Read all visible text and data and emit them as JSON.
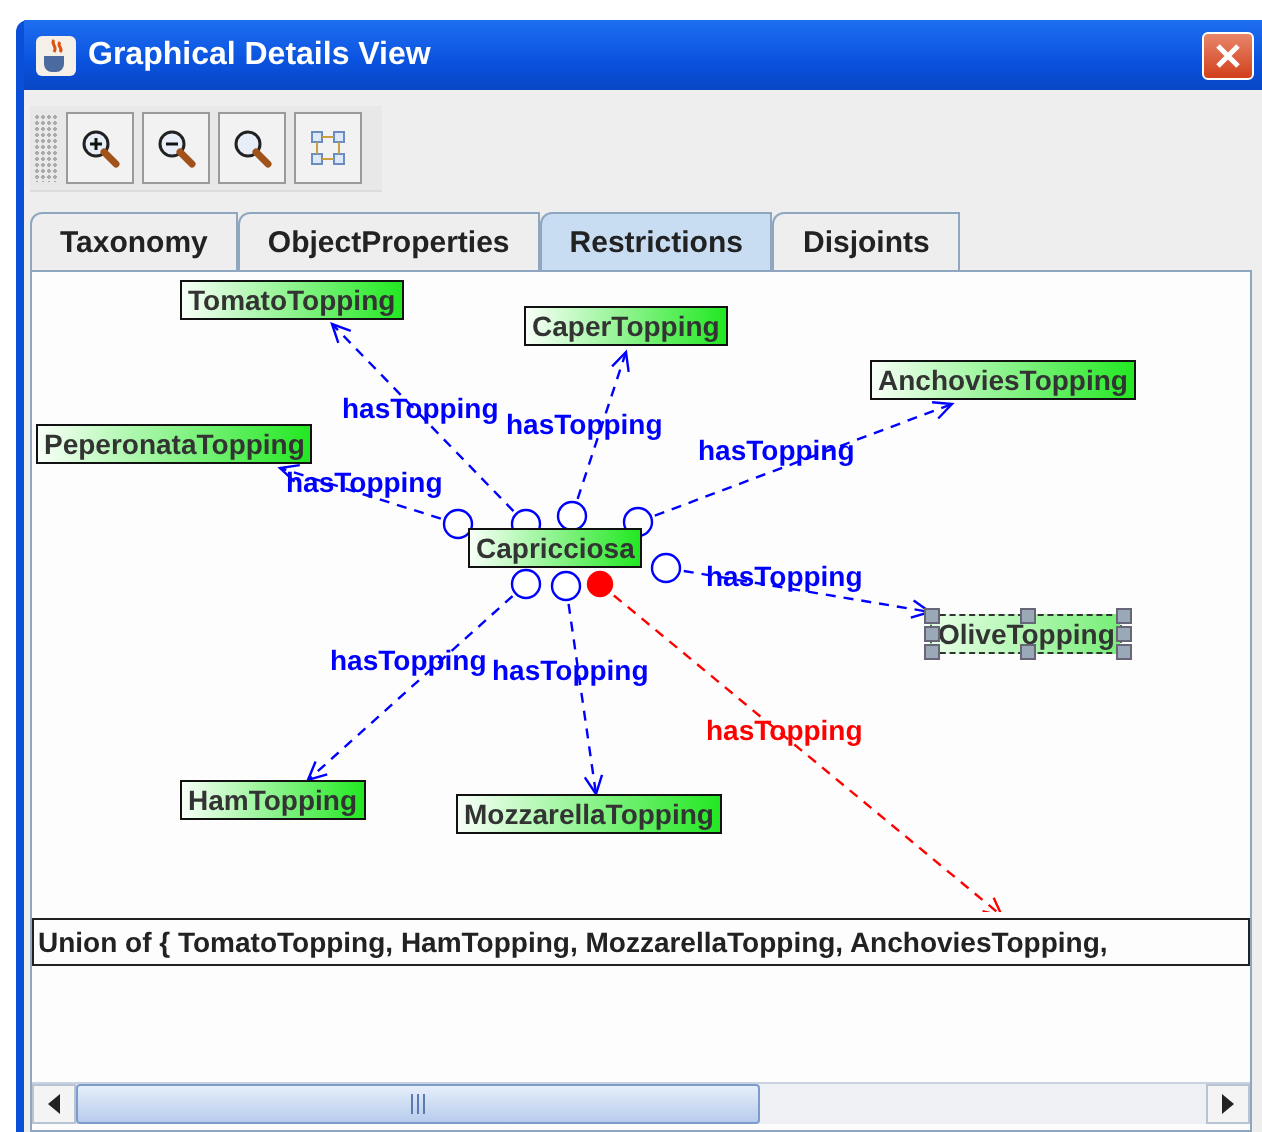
{
  "window": {
    "title": "Graphical Details View"
  },
  "toolbar": [
    {
      "kind": "zoom-in"
    },
    {
      "kind": "zoom-out"
    },
    {
      "kind": "zoom-fit"
    },
    {
      "kind": "layout"
    }
  ],
  "tabs": [
    {
      "label": "Taxonomy",
      "selected": false
    },
    {
      "label": "ObjectProperties",
      "selected": false
    },
    {
      "label": "Restrictions",
      "selected": true
    },
    {
      "label": "Disjoints",
      "selected": false
    }
  ],
  "diagram": {
    "nodes": [
      {
        "label": "TomatoTopping",
        "selected": false
      },
      {
        "label": "CaperTopping",
        "selected": false
      },
      {
        "label": "AnchoviesTopping",
        "selected": false
      },
      {
        "label": "PeperonataTopping",
        "selected": false
      },
      {
        "label": "Capricciosa",
        "selected": false
      },
      {
        "label": "OliveTopping",
        "selected": true
      },
      {
        "label": "HamTopping",
        "selected": false
      },
      {
        "label": "MozzarellaTopping",
        "selected": false
      }
    ],
    "edges": [
      {
        "label": "hasTopping",
        "color": "#0000ff"
      },
      {
        "label": "hasTopping",
        "color": "#0000ff"
      },
      {
        "label": "hasTopping",
        "color": "#0000ff"
      },
      {
        "label": "hasTopping",
        "color": "#0000ff"
      },
      {
        "label": "hasTopping",
        "color": "#0000ff"
      },
      {
        "label": "hasTopping",
        "color": "#0000ff"
      },
      {
        "label": "hasTopping",
        "color": "#0000ff"
      },
      {
        "label": "hasTopping",
        "color": "#ff0000"
      }
    ]
  },
  "union_text": "Union of { TomatoTopping, HamTopping, MozzarellaTopping, AnchoviesTopping,"
}
